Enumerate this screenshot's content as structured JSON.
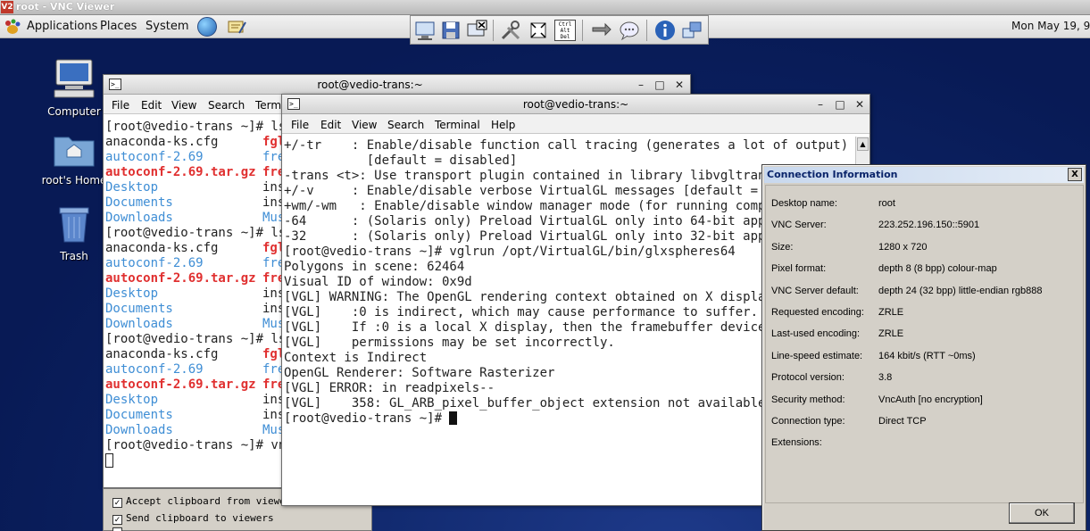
{
  "vnc": {
    "title": "root - VNC Viewer",
    "logo": "V2"
  },
  "panel": {
    "menus": [
      "Applications",
      "Places",
      "System"
    ],
    "clock": "Mon May 19,  9"
  },
  "toolbar": {
    "icons": [
      "options-icon",
      "save-icon",
      "close-connection-icon",
      "settings-icon",
      "fullscreen-icon",
      "ctrl-alt-del-icon",
      "transfer-icon",
      "chat-icon",
      "info-icon",
      "switch-icon"
    ],
    "ctrl_alt_del": "Ctrl Alt Del"
  },
  "desktop": {
    "icons": [
      {
        "label": "Computer"
      },
      {
        "label": "root's Home"
      },
      {
        "label": "Trash"
      }
    ]
  },
  "term_back": {
    "title": "root@vedio-trans:~",
    "menu": [
      "File",
      "Edit",
      "View",
      "Search",
      "Term"
    ],
    "lines": [
      [
        {
          "t": "[root@vedio-trans ~]# ls",
          "c": ""
        },
        {
          "t": "",
          "c": ""
        }
      ],
      [
        {
          "t": "anaconda-ks.cfg",
          "c": ""
        },
        {
          "t": "fgl",
          "c": "red"
        }
      ],
      [
        {
          "t": "autoconf-2.69",
          "c": "blue"
        },
        {
          "t": "fre",
          "c": "blue"
        }
      ],
      [
        {
          "t": "autoconf-2.69.tar.gz",
          "c": "red"
        },
        {
          "t": "fre",
          "c": "red"
        }
      ],
      [
        {
          "t": "Desktop",
          "c": "blue"
        },
        {
          "t": "ins",
          "c": ""
        }
      ],
      [
        {
          "t": "Documents",
          "c": "blue"
        },
        {
          "t": "ins",
          "c": ""
        }
      ],
      [
        {
          "t": "Downloads",
          "c": "blue"
        },
        {
          "t": "Mus",
          "c": "blue"
        }
      ],
      [
        {
          "t": "[root@vedio-trans ~]# ls",
          "c": ""
        },
        {
          "t": "",
          "c": ""
        }
      ],
      [
        {
          "t": "anaconda-ks.cfg",
          "c": ""
        },
        {
          "t": "fgl",
          "c": "red"
        }
      ],
      [
        {
          "t": "autoconf-2.69",
          "c": "blue"
        },
        {
          "t": "fre",
          "c": "blue"
        }
      ],
      [
        {
          "t": "autoconf-2.69.tar.gz",
          "c": "red"
        },
        {
          "t": "fre",
          "c": "red"
        }
      ],
      [
        {
          "t": "Desktop",
          "c": "blue"
        },
        {
          "t": "ins",
          "c": ""
        }
      ],
      [
        {
          "t": "Documents",
          "c": "blue"
        },
        {
          "t": "ins",
          "c": ""
        }
      ],
      [
        {
          "t": "Downloads",
          "c": "blue"
        },
        {
          "t": "Mus",
          "c": "blue"
        }
      ],
      [
        {
          "t": "[root@vedio-trans ~]# ls",
          "c": ""
        },
        {
          "t": "",
          "c": ""
        }
      ],
      [
        {
          "t": "anaconda-ks.cfg",
          "c": ""
        },
        {
          "t": "fgl",
          "c": "red"
        }
      ],
      [
        {
          "t": "autoconf-2.69",
          "c": "blue"
        },
        {
          "t": "fre",
          "c": "blue"
        }
      ],
      [
        {
          "t": "autoconf-2.69.tar.gz",
          "c": "red"
        },
        {
          "t": "fre",
          "c": "red"
        }
      ],
      [
        {
          "t": "Desktop",
          "c": "blue"
        },
        {
          "t": "ins",
          "c": ""
        }
      ],
      [
        {
          "t": "Documents",
          "c": "blue"
        },
        {
          "t": "ins",
          "c": ""
        }
      ],
      [
        {
          "t": "Downloads",
          "c": "blue"
        },
        {
          "t": "Mus",
          "c": "blue"
        }
      ],
      [
        {
          "t": "[root@vedio-trans ~]# vnc",
          "c": ""
        },
        {
          "t": "",
          "c": ""
        }
      ]
    ]
  },
  "term_front": {
    "title": "root@vedio-trans:~",
    "menu": [
      "File",
      "Edit",
      "View",
      "Search",
      "Terminal",
      "Help"
    ],
    "lines": [
      "+/-tr    : Enable/disable function call tracing (generates a lot of output)",
      "           [default = disabled]",
      "",
      "-trans <t>: Use transport plugin contained in library libvgltrans_<",
      "",
      "+/-v     : Enable/disable verbose VirtualGL messages [default = di",
      "",
      "+wm/-wm   : Enable/disable window manager mode (for running compiz,",
      "",
      "-64      : (Solaris only) Preload VirtualGL only into 64-bit apps",
      "-32      : (Solaris only) Preload VirtualGL only into 32-bit apps",
      "",
      "[root@vedio-trans ~]# vglrun /opt/VirtualGL/bin/glxspheres64",
      "Polygons in scene: 62464",
      "Visual ID of window: 0x9d",
      "[VGL] WARNING: The OpenGL rendering context obtained on X display",
      "[VGL]    :0 is indirect, which may cause performance to suffer.",
      "[VGL]    If :0 is a local X display, then the framebuffer device",
      "[VGL]    permissions may be set incorrectly.",
      "Context is Indirect",
      "OpenGL Renderer: Software Rasterizer",
      "[VGL] ERROR: in readpixels--",
      "[VGL]    358: GL_ARB_pixel_buffer_object extension not available",
      "[root@vedio-trans ~]# "
    ]
  },
  "clipboard": {
    "accept": "Accept clipboard from viewers",
    "send": "Send clipboard to viewers"
  },
  "conn_info": {
    "title": "Connection Information",
    "close": "X",
    "rows": [
      {
        "k": "Desktop name:",
        "v": "root"
      },
      {
        "k": "VNC Server:",
        "v": "223.252.196.150::5901"
      },
      {
        "k": "Size:",
        "v": "1280 x 720"
      },
      {
        "k": "Pixel format:",
        "v": "depth 8 (8 bpp) colour-map"
      },
      {
        "k": "VNC Server default:",
        "v": "depth 24 (32 bpp) little-endian rgb888"
      },
      {
        "k": "Requested encoding:",
        "v": "ZRLE"
      },
      {
        "k": "Last-used encoding:",
        "v": "ZRLE"
      },
      {
        "k": "Line-speed estimate:",
        "v": "164 kbit/s (RTT ~0ms)"
      },
      {
        "k": "Protocol version:",
        "v": "3.8"
      },
      {
        "k": "Security method:",
        "v": "VncAuth [no encryption]"
      },
      {
        "k": "Connection type:",
        "v": "Direct TCP"
      },
      {
        "k": "Extensions:",
        "v": ""
      }
    ],
    "ok": "OK"
  },
  "colors": {
    "term_blue": "#3f8ed5",
    "term_red": "#e03030",
    "desktop_bg": "#0a1a5c"
  }
}
